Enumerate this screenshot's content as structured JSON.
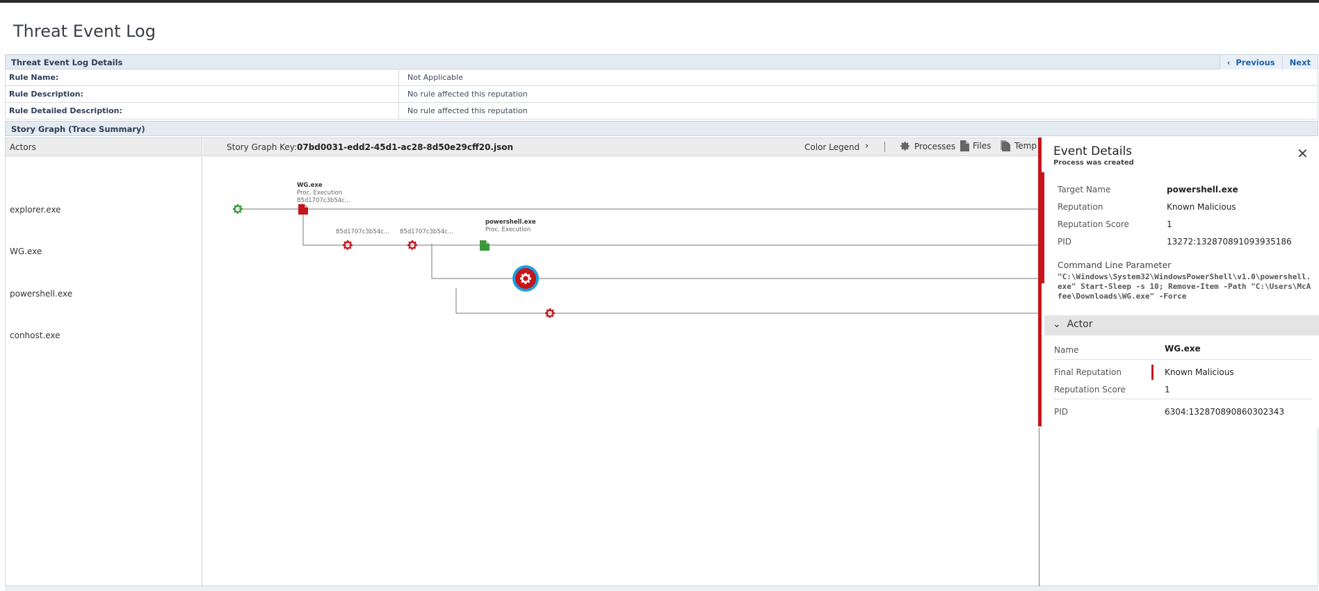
{
  "page": {
    "title": "Threat Event Log"
  },
  "details_section": {
    "title": "Threat Event Log Details",
    "previous_label": "Previous",
    "next_label": "Next",
    "rows": [
      {
        "label": "Rule Name:",
        "value": "Not Applicable"
      },
      {
        "label": "Rule Description:",
        "value": "No rule affected this reputation"
      },
      {
        "label": "Rule Detailed Description:",
        "value": "No rule affected this reputation"
      }
    ]
  },
  "story_section": {
    "title": "Story Graph (Trace Summary)"
  },
  "actors": {
    "header": "Actors",
    "items": [
      "explorer.exe",
      "WG.exe",
      "powershell.exe",
      "conhost.exe"
    ]
  },
  "graph_header": {
    "key_label": "Story Graph Key:",
    "key_value": "07bd0031-edd2-45d1-ac28-8d50e29cff20.json",
    "legend_label": "Color Legend",
    "tools": [
      "Processes",
      "Files",
      "Temp"
    ]
  },
  "graph": {
    "node_labels": {
      "wg_title": "WG.exe",
      "wg_sub": "Proc. Execution",
      "wg_hash": "85d1707c3b54c...",
      "hash_a": "85d1707c3b54c...",
      "hash_b": "85d1707c3b54c...",
      "ps_title": "powershell.exe",
      "ps_sub": "Proc. Execution"
    },
    "colors": {
      "malicious": "#c4161c",
      "clean": "#3c9a3c",
      "selected_ring": "#1aa0e0",
      "line": "#777777"
    }
  },
  "event_details": {
    "title": "Event Details",
    "subtitle": "Process was created",
    "fields": [
      {
        "label": "Target Name",
        "value": "powershell.exe"
      },
      {
        "label": "Reputation",
        "value": "Known Malicious"
      },
      {
        "label": "Reputation Score",
        "value": "1"
      },
      {
        "label": "PID",
        "value": "13272:132870891093935186"
      }
    ],
    "cmd_label": "Command Line Parameter",
    "cmd_value": "\"C:\\Windows\\System32\\WindowsPowerShell\\v1.0\\powershell.exe\" Start-Sleep -s 10; Remove-Item -Path \"C:\\Users\\McAfee\\Downloads\\WG.exe\" -Force",
    "actor_section": {
      "title": "Actor",
      "fields": [
        {
          "label": "Name",
          "value": "WG.exe"
        },
        {
          "label": "Final Reputation",
          "value": "Known Malicious"
        },
        {
          "label": "Reputation Score",
          "value": "1"
        },
        {
          "label": "PID",
          "value": "6304:132870890860302343"
        }
      ]
    }
  }
}
